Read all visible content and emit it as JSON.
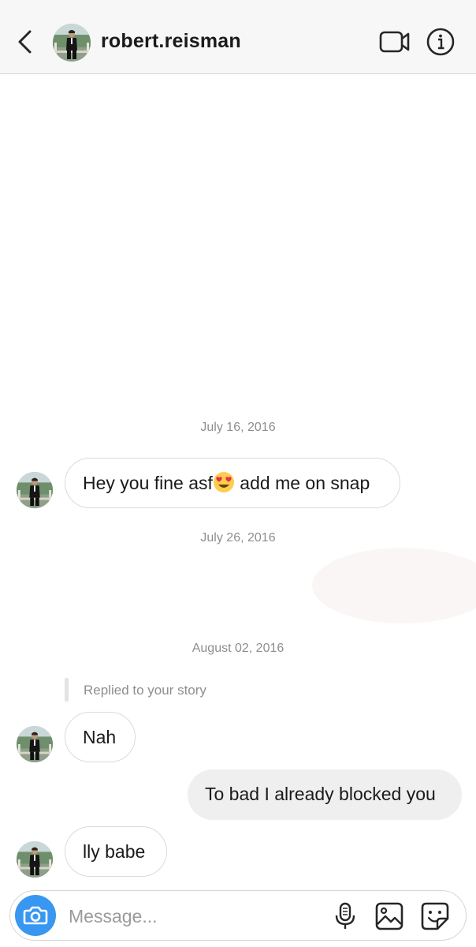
{
  "header": {
    "username": "robert.reisman",
    "icons": {
      "back": "chevron-left-icon",
      "video": "video-camera-icon",
      "info": "info-icon"
    }
  },
  "thread": {
    "date_1": "July 16, 2016",
    "message_1": "Hey you fine asf",
    "message_1_suffix": " add me on snap",
    "message_1_emoji": "heart-eyes-emoji",
    "date_2": "July 26, 2016",
    "date_3": "August 02, 2016",
    "reply_label": "Replied to your story",
    "message_2": "Nah",
    "message_3": "To bad I already blocked you",
    "message_4": "lly babe"
  },
  "composer": {
    "placeholder": "Message...",
    "value": "",
    "icons": {
      "camera": "camera-icon",
      "mic": "microphone-icon",
      "gallery": "gallery-icon",
      "sticker": "sticker-icon"
    }
  },
  "colors": {
    "accent": "#3897f0",
    "incoming_border": "#dbdbdb",
    "outgoing_bg": "#efefef",
    "meta_text": "#8e8e8e"
  }
}
